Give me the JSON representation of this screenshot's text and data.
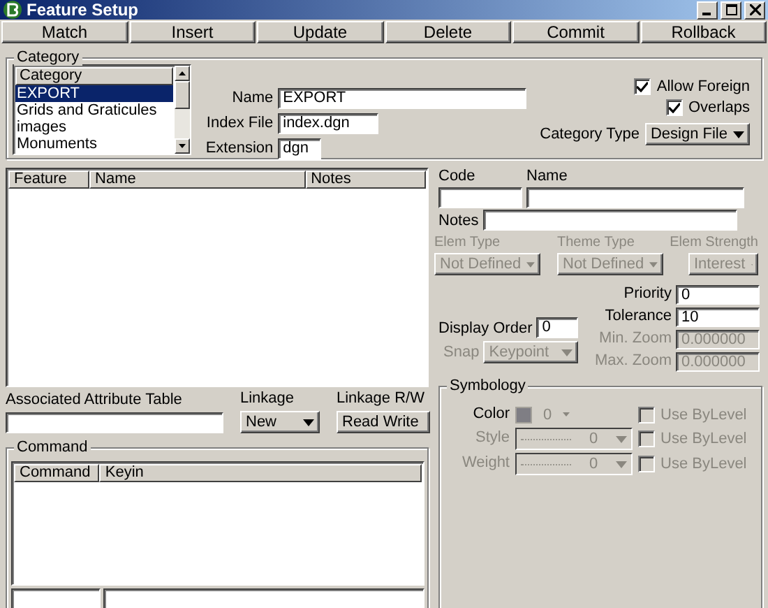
{
  "window": {
    "title": "Feature Setup"
  },
  "toolbar": [
    {
      "label": "Match"
    },
    {
      "label": "Insert"
    },
    {
      "label": "Update"
    },
    {
      "label": "Delete"
    },
    {
      "label": "Commit"
    },
    {
      "label": "Rollback"
    }
  ],
  "category": {
    "group_label": "Category",
    "list_header": "Category",
    "items": [
      {
        "label": "EXPORT",
        "selected": true
      },
      {
        "label": "Grids and Graticules",
        "selected": false
      },
      {
        "label": "images",
        "selected": false
      },
      {
        "label": "Monuments",
        "selected": false
      }
    ],
    "fields": [
      {
        "label": "Name",
        "value": "EXPORT"
      },
      {
        "label": "Index File",
        "value": "index.dgn"
      },
      {
        "label": "Extension",
        "value": "dgn"
      }
    ],
    "checks": [
      {
        "label": "Allow Foreign",
        "checked": true
      },
      {
        "label": "Overlaps",
        "checked": true
      }
    ],
    "type_label": "Category Type",
    "type_value": "Design File"
  },
  "features": {
    "columns": [
      "Feature",
      "Name",
      "Notes"
    ]
  },
  "attribute_table": {
    "label": "Associated Attribute Table"
  },
  "linkage": {
    "label": "Linkage",
    "value": "New"
  },
  "linkage_rw": {
    "label": "Linkage R/W",
    "value": "Read Write"
  },
  "command": {
    "group_label": "Command",
    "columns": [
      "Command",
      "Keyin"
    ]
  },
  "detail": {
    "code_label": "Code",
    "name_label": "Name",
    "notes_label": "Notes",
    "dropdowns": [
      {
        "label": "Elem Type",
        "value": "Not Defined",
        "disabled": true
      },
      {
        "label": "Theme Type",
        "value": "Not Defined",
        "disabled": true
      },
      {
        "label": "Elem Strength",
        "value": "Interest",
        "disabled": true
      }
    ],
    "display_order": {
      "label": "Display Order",
      "value": "0"
    },
    "snap": {
      "label": "Snap",
      "value": "Keypoint",
      "disabled": true
    },
    "numbers": [
      {
        "label": "Priority",
        "value": "0",
        "disabled": false
      },
      {
        "label": "Tolerance",
        "value": "10",
        "disabled": false
      },
      {
        "label": "Min. Zoom",
        "value": "0.000000",
        "disabled": true
      },
      {
        "label": "Max. Zoom",
        "value": "0.000000",
        "disabled": true
      }
    ]
  },
  "symbology": {
    "group_label": "Symbology",
    "rows": [
      {
        "kind": "color",
        "label": "Color",
        "value": "0",
        "disabled": false,
        "by_level": {
          "label": "Use ByLevel",
          "checked": false,
          "disabled": true
        }
      },
      {
        "kind": "line",
        "label": "Style",
        "value": "0",
        "disabled": true,
        "by_level": {
          "label": "Use ByLevel",
          "checked": false,
          "disabled": true
        }
      },
      {
        "kind": "line",
        "label": "Weight",
        "value": "0",
        "disabled": true,
        "by_level": {
          "label": "Use ByLevel",
          "checked": false,
          "disabled": true
        }
      }
    ]
  }
}
